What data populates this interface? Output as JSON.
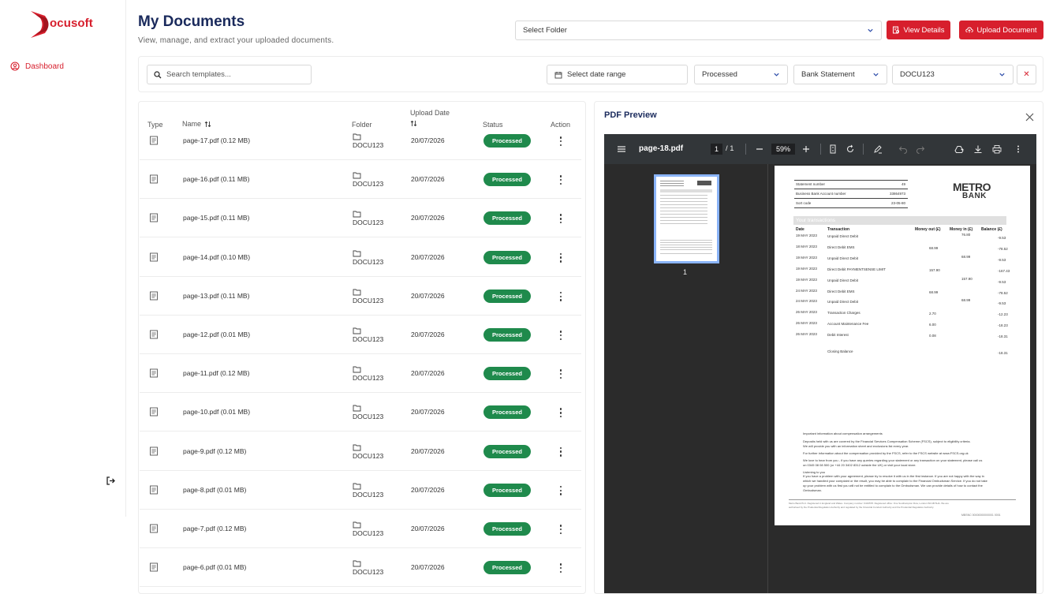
{
  "sidebar": {
    "logo_text": "ocusoft",
    "items": [
      {
        "label": "Dashboard",
        "icon": "user-circle-icon"
      }
    ],
    "logout_icon": "logout-icon"
  },
  "header": {
    "title": "My Documents",
    "subtitle": "View, manage, and extract your uploaded documents.",
    "folder_select": "Select Folder",
    "view_details": "View Details",
    "upload_document": "Upload Document"
  },
  "filters": {
    "search_placeholder": "Search templates...",
    "date_range": "Select date range",
    "status": "Processed",
    "doc_type": "Bank Statement",
    "code": "DOCU123",
    "clear": "✕"
  },
  "table": {
    "columns": {
      "type": "Type",
      "name": "Name",
      "folder": "Folder",
      "upload_date": "Upload Date",
      "status": "Status",
      "action": "Action"
    },
    "rows": [
      {
        "name": "page-17.pdf (0.12 MB)",
        "folder": "DOCU123",
        "date": "20/07/2026",
        "status": "Processed"
      },
      {
        "name": "page-16.pdf (0.11 MB)",
        "folder": "DOCU123",
        "date": "20/07/2026",
        "status": "Processed"
      },
      {
        "name": "page-15.pdf (0.11 MB)",
        "folder": "DOCU123",
        "date": "20/07/2026",
        "status": "Processed"
      },
      {
        "name": "page-14.pdf (0.10 MB)",
        "folder": "DOCU123",
        "date": "20/07/2026",
        "status": "Processed"
      },
      {
        "name": "page-13.pdf (0.11 MB)",
        "folder": "DOCU123",
        "date": "20/07/2026",
        "status": "Processed"
      },
      {
        "name": "page-12.pdf (0.01 MB)",
        "folder": "DOCU123",
        "date": "20/07/2026",
        "status": "Processed"
      },
      {
        "name": "page-11.pdf (0.12 MB)",
        "folder": "DOCU123",
        "date": "20/07/2026",
        "status": "Processed"
      },
      {
        "name": "page-10.pdf (0.01 MB)",
        "folder": "DOCU123",
        "date": "20/07/2026",
        "status": "Processed"
      },
      {
        "name": "page-9.pdf (0.12 MB)",
        "folder": "DOCU123",
        "date": "20/07/2026",
        "status": "Processed"
      },
      {
        "name": "page-8.pdf (0.01 MB)",
        "folder": "DOCU123",
        "date": "20/07/2026",
        "status": "Processed"
      },
      {
        "name": "page-7.pdf (0.12 MB)",
        "folder": "DOCU123",
        "date": "20/07/2026",
        "status": "Processed"
      },
      {
        "name": "page-6.pdf (0.01 MB)",
        "folder": "DOCU123",
        "date": "20/07/2026",
        "status": "Processed"
      }
    ]
  },
  "preview": {
    "title": "PDF Preview",
    "file_name": "page-18.pdf",
    "current_page": "1",
    "total_pages": "/ 1",
    "zoom": "59%",
    "thumb_label": "1",
    "document": {
      "bank_name_1": "METRO",
      "bank_name_2": "BANK",
      "header_rows": [
        {
          "label": "Statement number",
          "value": "49"
        },
        {
          "label": "Business Bank Account number",
          "value": "33864973"
        },
        {
          "label": "Sort code",
          "value": "23-05-80"
        }
      ],
      "section_title": "Your transactions",
      "columns": [
        "Date",
        "Transaction",
        "Money out (£)",
        "Money in (£)",
        "Balance (£)"
      ],
      "transactions": [
        {
          "date": "19 MAY 2023",
          "desc": "Unpaid Direct Debit",
          "out": "",
          "in": "76.80",
          "bal": "-9.53"
        },
        {
          "date": "18 MAY 2023",
          "desc": "Direct Debit EMS",
          "out": "68.99",
          "in": "",
          "bal": "-78.52"
        },
        {
          "date": "19 MAY 2023",
          "desc": "Unpaid Direct Debit",
          "out": "",
          "in": "68.99",
          "bal": "-9.53"
        },
        {
          "date": "19 MAY 2023",
          "desc": "Direct Debit PAYMENTSENSE LIMIT",
          "out": "157.90",
          "in": "",
          "bal": "-167.43"
        },
        {
          "date": "19 MAY 2023",
          "desc": "Unpaid Direct Debit",
          "out": "",
          "in": "157.90",
          "bal": "-9.53"
        },
        {
          "date": "24 MAY 2023",
          "desc": "Direct Debit EMS",
          "out": "68.99",
          "in": "",
          "bal": "-78.52"
        },
        {
          "date": "24 MAY 2023",
          "desc": "Unpaid Direct Debit",
          "out": "",
          "in": "68.99",
          "bal": "-9.53"
        },
        {
          "date": "26 MAY 2023",
          "desc": "Transaction Charges",
          "out": "2.70",
          "in": "",
          "bal": "-12.23"
        },
        {
          "date": "26 MAY 2023",
          "desc": "Account Maintenance Fee",
          "out": "6.00",
          "in": "",
          "bal": "-18.23"
        },
        {
          "date": "26 MAY 2023",
          "desc": "Debit Interest",
          "out": "0.08",
          "in": "",
          "bal": "-18.31"
        }
      ],
      "closing_label": "Closing Balance",
      "closing_value": "-18.31",
      "footer_lines": [
        "Important information about compensation arrangements",
        "Deposits held with us are covered by the Financial Services Compensation Scheme (FSCS), subject to eligibility criteria.",
        "We will provide you with an information sheet and exclusions list every year.",
        "For further information about the compensation provided by the FSCS, refer to the FSCS website at www.FSCS.org.uk",
        "We love to hear from you - if you have any queries regarding your statement or any transaction on your statement, please call us",
        "on 0345 08 08 500 (or +44 20 3402 8312 outside the UK) or visit your local store.",
        "Listening to you",
        "If you have a problem with your agreement, please try to resolve it with us in the first instance. If you are not happy with the way in",
        "which we handled your complaint or the result, you may be able to complain to the Financial Ombudsman Service. If you do not take",
        "up your problem with us first you will not be entitled to complain to the Ombudsman. We can provide details of how to contact the",
        "Ombudsman."
      ],
      "legal_lines": [
        "Metro Bank PLC. Registered in England and Wales. Company number: 6419578. Registered office: One Southampton Row, London WC1B 5HA. We are",
        "authorised by the Prudential Regulation Authority and regulated by the Financial Conduct Authority and the Prudential Regulation Authority."
      ],
      "page_code": "MBSNC 00000000000001 0001"
    }
  }
}
